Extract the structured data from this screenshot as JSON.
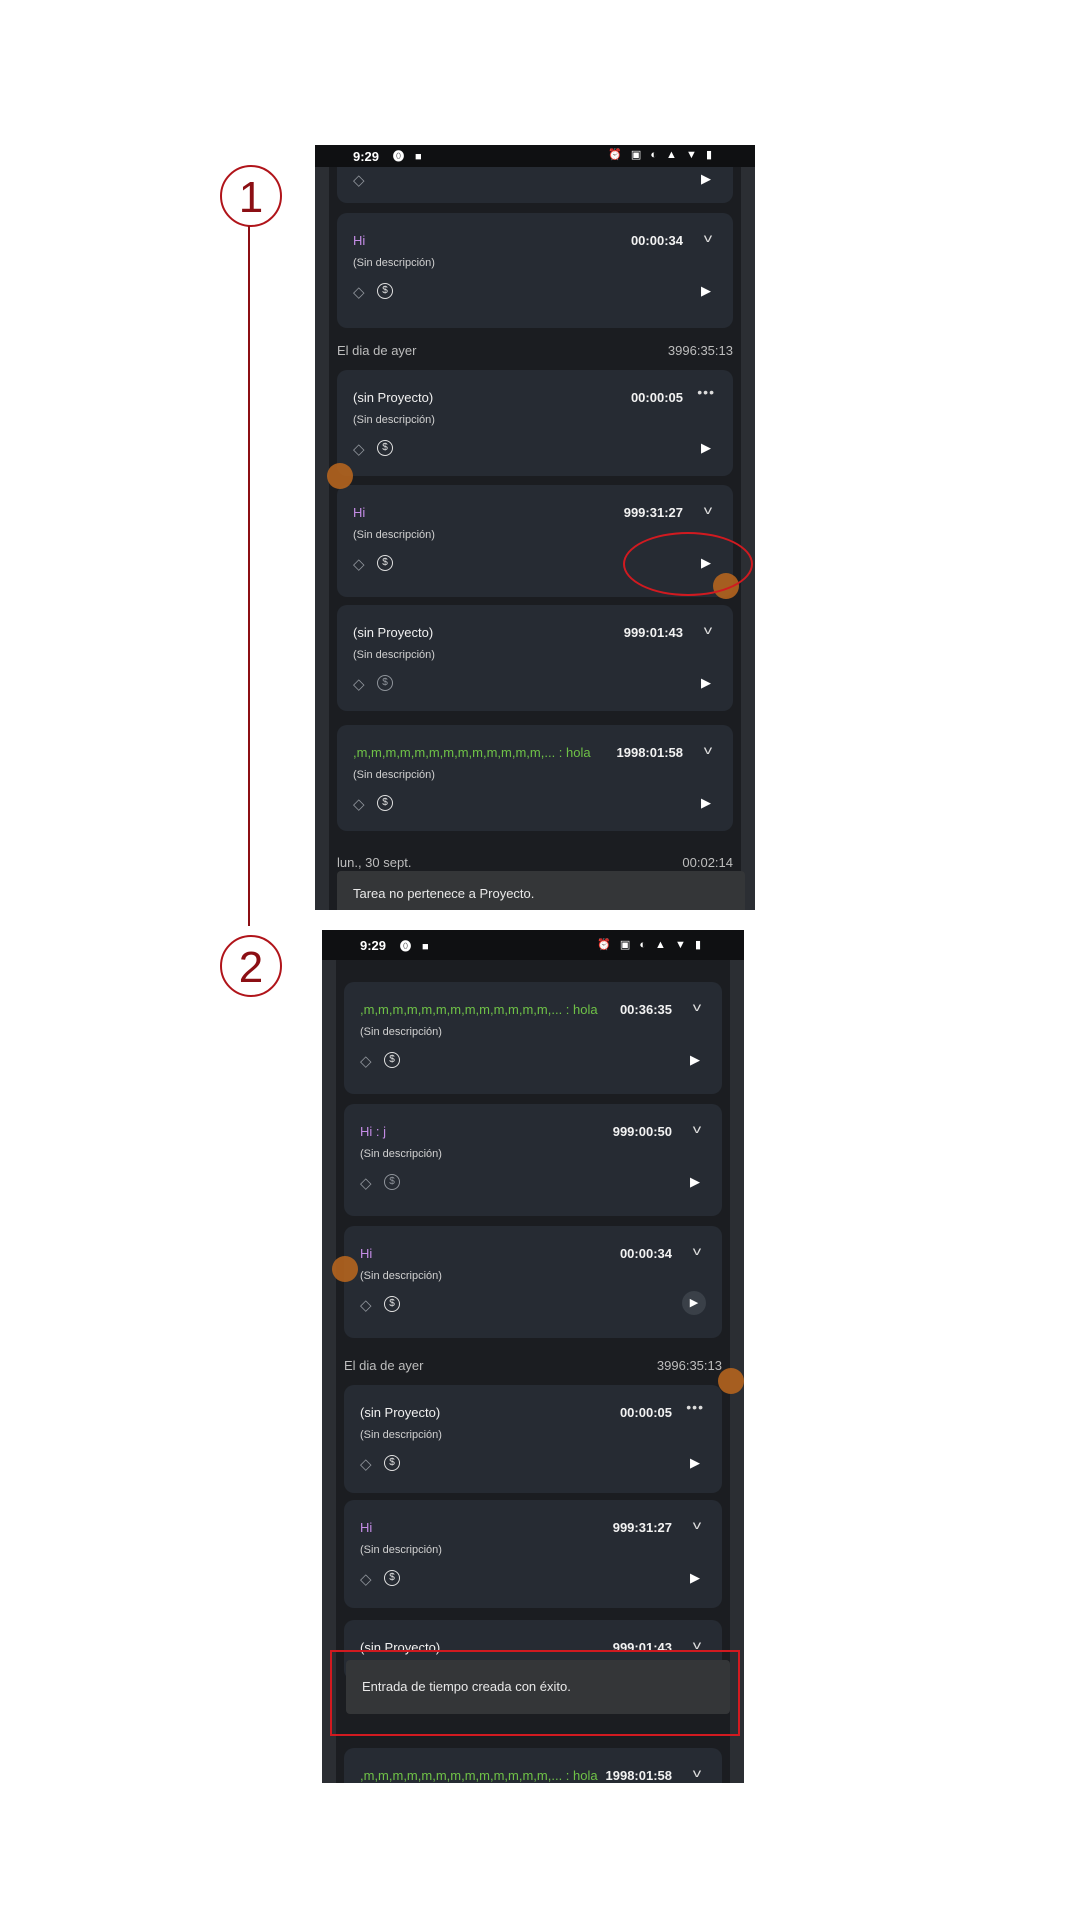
{
  "steps": {
    "one": "1",
    "two": "2"
  },
  "status": {
    "time": "9:29",
    "left_icons": "⓿ ■",
    "right_icons": "⏰ ▣ ◐ ▲ ▼ ▮"
  },
  "screen1": {
    "cards": [
      {
        "title": "Hi",
        "duration": "00:00:34",
        "desc": "(Sin descripción)"
      },
      {
        "title": "(sin Proyecto)",
        "duration": "00:00:05",
        "desc": "(Sin descripción)"
      },
      {
        "title": "Hi",
        "duration": "999:31:27",
        "desc": "(Sin descripción)"
      },
      {
        "title": "(sin Proyecto)",
        "duration": "999:01:43",
        "desc": "(Sin descripción)"
      },
      {
        "title": ",m,m,m,m,m,m,m,m,m,m,m,m,m,...",
        "client": " : hola",
        "duration": "1998:01:58",
        "desc": "(Sin descripción)"
      }
    ],
    "section_yesterday": {
      "label": "El dia de ayer",
      "total": "3996:35:13"
    },
    "section_date": {
      "label": "lun., 30 sept.",
      "total": "00:02:14"
    },
    "snackbar": "Tarea no pertenece a Proyecto."
  },
  "screen2": {
    "cards": [
      {
        "title": ",m,m,m,m,m,m,m,m,m,m,m,m,m,...",
        "client": " : hola",
        "duration": "00:36:35",
        "desc": "(Sin descripción)"
      },
      {
        "title": "Hi : j",
        "duration": "999:00:50",
        "desc": "(Sin descripción)"
      },
      {
        "title": "Hi",
        "duration": "00:00:34",
        "desc": "(Sin descripción)"
      },
      {
        "title": "(sin Proyecto)",
        "duration": "00:00:05",
        "desc": "(Sin descripción)"
      },
      {
        "title": "Hi",
        "duration": "999:31:27",
        "desc": "(Sin descripción)"
      },
      {
        "title": "(sin Proyecto)",
        "duration": "999:01:43",
        "desc": ""
      },
      {
        "title": ",m,m,m,m,m,m,m,m,m,m,m,m,m,...",
        "client": " : hola",
        "duration": "1998:01:58",
        "desc": ""
      }
    ],
    "section_yesterday": {
      "label": "El dia de ayer",
      "total": "3996:35:13"
    },
    "snackbar": "Entrada de tiempo creada con éxito."
  },
  "icons": {
    "chevron": "chevron-down-icon",
    "play": "play-icon",
    "tag": "tag-icon",
    "dollar": "dollar-icon",
    "more": "more-horizontal-icon"
  },
  "glyphs": {
    "chevron": "v",
    "play": "▶",
    "tag": "◇",
    "dollar": "$",
    "more": "•••"
  },
  "colors": {
    "purple_project": "#c48ce6",
    "green_project": "#6fc247",
    "highlight": "#d11a20",
    "step_marker": "#8c0f14"
  }
}
